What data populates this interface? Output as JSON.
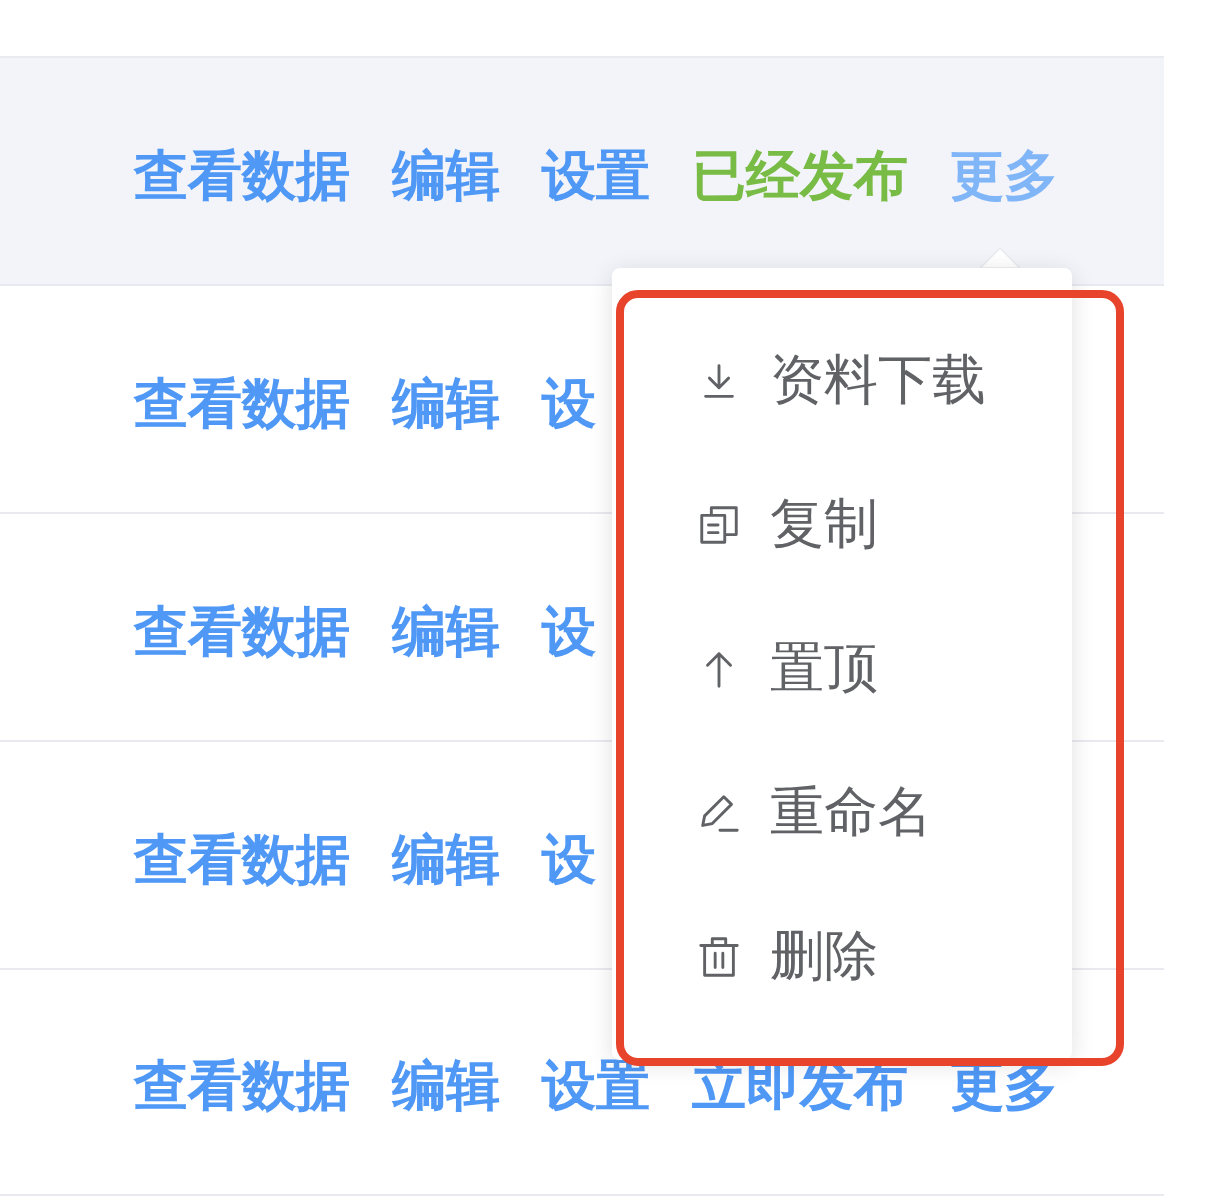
{
  "table": {
    "rows": [
      {
        "hovered": true,
        "actions": [
          {
            "kind": "link",
            "label": "查看数据"
          },
          {
            "kind": "link",
            "label": "编辑"
          },
          {
            "kind": "link",
            "label": "设置"
          },
          {
            "kind": "status",
            "label": "已经发布"
          },
          {
            "kind": "more",
            "label": "更多",
            "open": true
          }
        ]
      },
      {
        "hovered": false,
        "actions": [
          {
            "kind": "link",
            "label": "查看数据"
          },
          {
            "kind": "link",
            "label": "编辑"
          },
          {
            "kind": "link",
            "label": "设"
          }
        ]
      },
      {
        "hovered": false,
        "actions": [
          {
            "kind": "link",
            "label": "查看数据"
          },
          {
            "kind": "link",
            "label": "编辑"
          },
          {
            "kind": "link",
            "label": "设"
          }
        ]
      },
      {
        "hovered": false,
        "actions": [
          {
            "kind": "link",
            "label": "查看数据"
          },
          {
            "kind": "link",
            "label": "编辑"
          },
          {
            "kind": "link",
            "label": "设"
          }
        ]
      },
      {
        "hovered": false,
        "actions": [
          {
            "kind": "link",
            "label": "查看数据"
          },
          {
            "kind": "link",
            "label": "编辑"
          },
          {
            "kind": "link",
            "label": "设置"
          },
          {
            "kind": "link",
            "label": "立即发布"
          },
          {
            "kind": "more",
            "label": "更多",
            "open": false
          }
        ]
      }
    ]
  },
  "dropdown": {
    "highlighted": true,
    "items": [
      {
        "label": "资料下载"
      },
      {
        "label": "复制"
      },
      {
        "label": "置顶"
      },
      {
        "label": "重命名"
      },
      {
        "label": "删除"
      }
    ]
  }
}
